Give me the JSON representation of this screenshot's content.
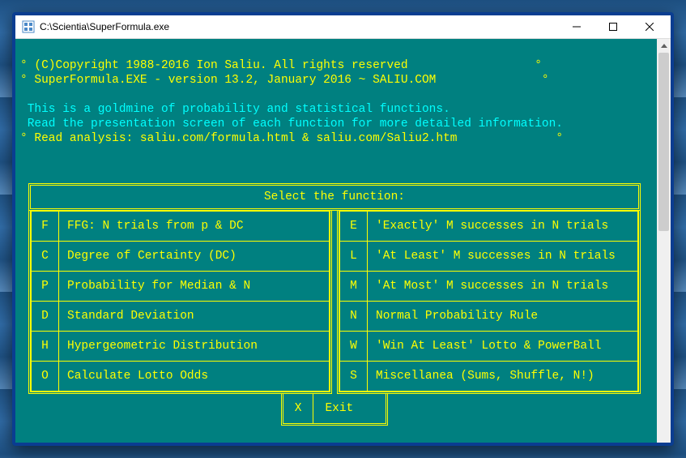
{
  "window": {
    "title": "C:\\Scientia\\SuperFormula.exe"
  },
  "header": {
    "copyright": "(C)Copyright 1988-2016 Ion Saliu. All rights reserved",
    "version": "SuperFormula.EXE - version 13.2, January 2016 ~ SALIU.COM",
    "intro_line1": "This is a goldmine of probability and statistical functions.",
    "intro_line2": "Read the presentation screen of each function for more detailed information.",
    "analysis": "Read analysis: saliu.com/formula.html & saliu.com/Saliu2.htm"
  },
  "menu": {
    "title": "Select the function:",
    "left": [
      {
        "key": "F",
        "label": "FFG: N trials from p & DC"
      },
      {
        "key": "C",
        "label": "Degree of Certainty (DC)"
      },
      {
        "key": "P",
        "label": "Probability for Median & N"
      },
      {
        "key": "D",
        "label": "Standard Deviation"
      },
      {
        "key": "H",
        "label": "Hypergeometric Distribution"
      },
      {
        "key": "O",
        "label": "Calculate Lotto Odds"
      }
    ],
    "right": [
      {
        "key": "E",
        "label": "'Exactly' M successes in N trials"
      },
      {
        "key": "L",
        "label": "'At Least' M successes in N trials"
      },
      {
        "key": "M",
        "label": "'At Most' M successes in N trials"
      },
      {
        "key": "N",
        "label": "Normal Probability Rule"
      },
      {
        "key": "W",
        "label": "'Win At Least' Lotto & PowerBall"
      },
      {
        "key": "S",
        "label": "Miscellanea (Sums, Shuffle, N!)"
      }
    ],
    "exit": {
      "key": "X",
      "label": "Exit"
    }
  },
  "degree_mark": "°"
}
